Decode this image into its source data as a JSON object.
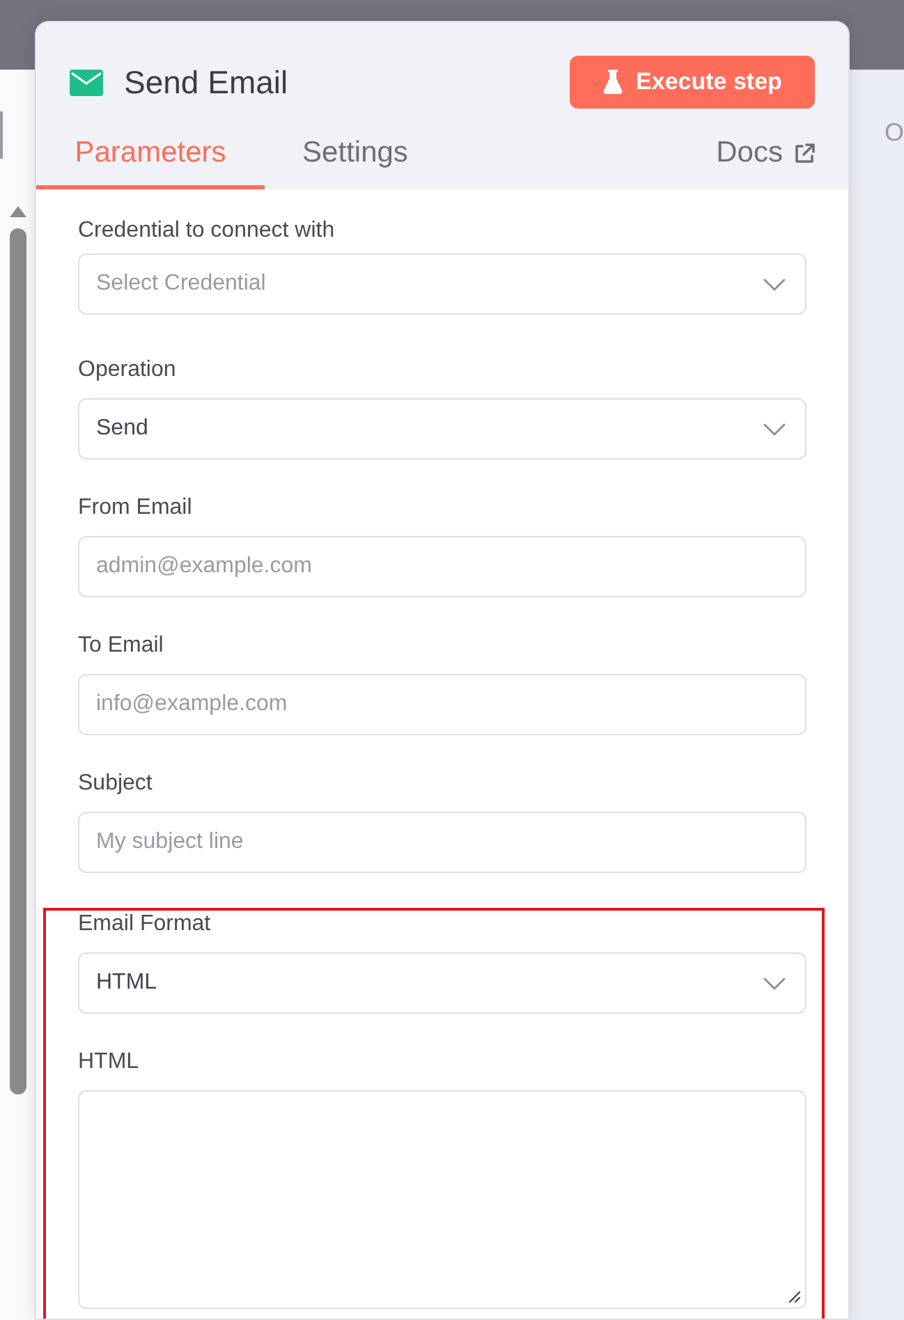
{
  "header": {
    "title": "Send Email",
    "execute_button": "Execute step"
  },
  "tabs": [
    {
      "label": "Parameters",
      "selected": true
    },
    {
      "label": "Settings",
      "selected": false
    }
  ],
  "docs_link": "Docs",
  "fields": [
    {
      "kind": "select",
      "label": "Credential to connect with",
      "placeholder": "Select Credential",
      "highlighted": false
    },
    {
      "kind": "select",
      "label": "Operation",
      "value": "Send",
      "highlighted": false
    },
    {
      "kind": "input",
      "label": "From Email",
      "placeholder": "admin@example.com",
      "highlighted": false
    },
    {
      "kind": "input",
      "label": "To Email",
      "placeholder": "info@example.com",
      "highlighted": false
    },
    {
      "kind": "input",
      "label": "Subject",
      "placeholder": "My subject line",
      "highlighted": false
    },
    {
      "kind": "select",
      "label": "Email Format",
      "value": "HTML",
      "highlighted": true
    },
    {
      "kind": "textarea",
      "label": "HTML",
      "highlighted": true
    }
  ],
  "output_panel": {
    "title": "O"
  }
}
